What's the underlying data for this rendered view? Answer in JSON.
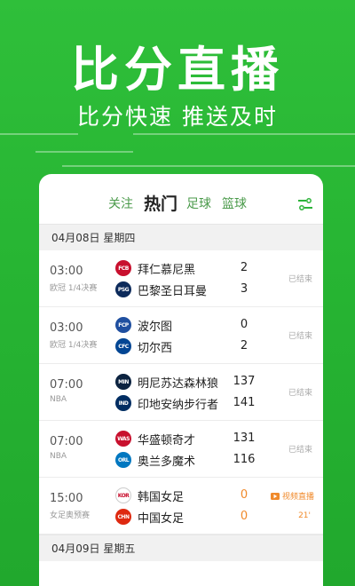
{
  "hero": {
    "title": "比分直播",
    "subtitle": "比分快速 推送及时"
  },
  "tabs": [
    {
      "label": "关注",
      "active": false
    },
    {
      "label": "热门",
      "active": true
    },
    {
      "label": "足球",
      "active": false
    },
    {
      "label": "篮球",
      "active": false
    }
  ],
  "date_bars": [
    "04月08日 星期四",
    "04月09日 星期五"
  ],
  "matches": [
    {
      "time": "03:00",
      "league": "欧冠 1/4决赛",
      "home": {
        "name": "拜仁慕尼黑",
        "logo_color": "#c8102e",
        "logo_text": "FCB"
      },
      "away": {
        "name": "巴黎圣日耳曼",
        "logo_color": "#0c2a5b",
        "logo_text": "PSG"
      },
      "home_score": "2",
      "away_score": "3",
      "status": "已结束"
    },
    {
      "time": "03:00",
      "league": "欧冠 1/4决赛",
      "home": {
        "name": "波尔图",
        "logo_color": "#1f4fa0",
        "logo_text": "FCP"
      },
      "away": {
        "name": "切尔西",
        "logo_color": "#034694",
        "logo_text": "CFC"
      },
      "home_score": "0",
      "away_score": "2",
      "status": "已结束"
    },
    {
      "time": "07:00",
      "league": "NBA",
      "home": {
        "name": "明尼苏达森林狼",
        "logo_color": "#0c2340",
        "logo_text": "MIN"
      },
      "away": {
        "name": "印地安纳步行者",
        "logo_color": "#002d62",
        "logo_text": "IND"
      },
      "home_score": "137",
      "away_score": "141",
      "status": "已结束"
    },
    {
      "time": "07:00",
      "league": "NBA",
      "home": {
        "name": "华盛顿奇才",
        "logo_color": "#c8102e",
        "logo_text": "WAS"
      },
      "away": {
        "name": "奥兰多魔术",
        "logo_color": "#0077c0",
        "logo_text": "ORL"
      },
      "home_score": "131",
      "away_score": "116",
      "status": "已结束"
    },
    {
      "time": "15:00",
      "league": "女足奥预赛",
      "home": {
        "name": "韩国女足",
        "logo_color": "#ffffff",
        "logo_text": "KOR"
      },
      "away": {
        "name": "中国女足",
        "logo_color": "#de2910",
        "logo_text": "CHN"
      },
      "home_score": "0",
      "away_score": "0",
      "live": true,
      "live_label": "视频直播",
      "minute": "21'"
    }
  ],
  "colors": {
    "brand_green": "#27b533",
    "live_orange": "#f08a2b"
  },
  "icons": {
    "filter": "filter-sort-icon",
    "live": "play-video-icon"
  }
}
